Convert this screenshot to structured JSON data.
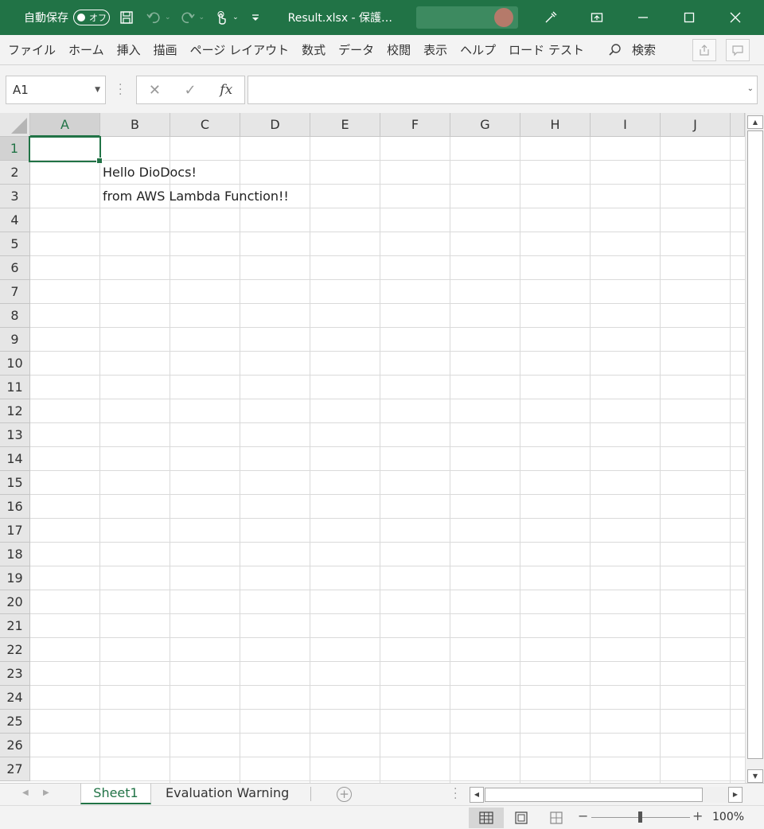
{
  "titlebar": {
    "autosave_label": "自動保存",
    "autosave_toggle": "オフ",
    "doc_title": "Result.xlsx  -  保護…"
  },
  "ribbon": {
    "tabs": [
      "ファイル",
      "ホーム",
      "挿入",
      "描画",
      "ページ レイアウト",
      "数式",
      "データ",
      "校閲",
      "表示",
      "ヘルプ",
      "ロード テスト"
    ],
    "search_label": "検索"
  },
  "formula_bar": {
    "name_box": "A1",
    "cancel": "✕",
    "enter": "✓",
    "fx": "fx",
    "formula_value": ""
  },
  "sheet": {
    "columns": [
      "A",
      "B",
      "C",
      "D",
      "E",
      "F",
      "G",
      "H",
      "I",
      "J"
    ],
    "rows": [
      "1",
      "2",
      "3",
      "4",
      "5",
      "6",
      "7",
      "8",
      "9",
      "10",
      "11",
      "12",
      "13",
      "14",
      "15",
      "16",
      "17",
      "18",
      "19",
      "20",
      "21",
      "22",
      "23",
      "24",
      "25",
      "26",
      "27"
    ],
    "selected_cell": "A1",
    "cell_B2": "Hello DioDocs!",
    "cell_B3": "from AWS Lambda Function!!"
  },
  "sheet_tabs": [
    "Sheet1",
    "Evaluation Warning"
  ],
  "statusbar": {
    "zoom_level": "100%",
    "zoom_fraction": 0.5
  },
  "colors": {
    "accent": "#217346"
  }
}
